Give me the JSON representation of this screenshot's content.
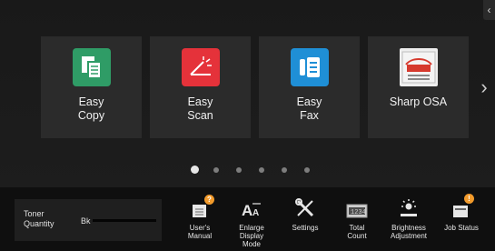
{
  "colors": {
    "copy_tile": "#2f9c66",
    "scan_tile": "#e5323a",
    "fax_tile": "#1f8fd6",
    "badge": "#f19a2b"
  },
  "apps": [
    {
      "label": "Easy\nCopy",
      "icon": "copy-icon"
    },
    {
      "label": "Easy\nScan",
      "icon": "scan-icon"
    },
    {
      "label": "Easy\nFax",
      "icon": "fax-icon"
    },
    {
      "label": "Sharp OSA",
      "icon": "sharp-osa-icon"
    }
  ],
  "pager": {
    "total_pages": 6,
    "active_page": 1
  },
  "toner": {
    "label": "Toner\nQuantity",
    "bk_label": "Bk"
  },
  "bottom_buttons": [
    {
      "label": "User's\nManual",
      "icon": "manual-icon"
    },
    {
      "label": "Enlarge\nDisplay\nMode",
      "icon": "enlarge-display-icon"
    },
    {
      "label": "Settings",
      "icon": "settings-icon"
    },
    {
      "label": "Total\nCount",
      "icon": "total-count-icon"
    },
    {
      "label": "Brightness\nAdjustment",
      "icon": "brightness-icon"
    },
    {
      "label": "Job Status",
      "icon": "job-status-icon"
    }
  ]
}
